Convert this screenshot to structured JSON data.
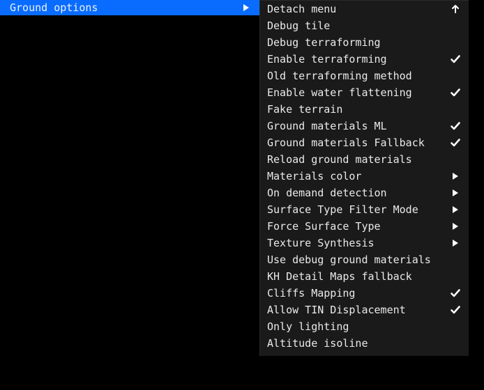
{
  "main": {
    "label": "Ground options",
    "selected": true,
    "icon": "submenu"
  },
  "submenu": {
    "items": [
      {
        "label": "Detach menu",
        "icon": "detach"
      },
      {
        "label": "Debug tile",
        "icon": "none"
      },
      {
        "label": "Debug terraforming",
        "icon": "none"
      },
      {
        "label": "Enable terraforming",
        "icon": "check"
      },
      {
        "label": "Old terraforming method",
        "icon": "none"
      },
      {
        "label": "Enable water flattening",
        "icon": "check"
      },
      {
        "label": "Fake terrain",
        "icon": "none"
      },
      {
        "label": "Ground materials ML",
        "icon": "check"
      },
      {
        "label": "Ground materials Fallback",
        "icon": "check"
      },
      {
        "label": "Reload ground materials",
        "icon": "none"
      },
      {
        "label": "Materials color",
        "icon": "submenu"
      },
      {
        "label": "On demand detection",
        "icon": "submenu"
      },
      {
        "label": "Surface Type Filter Mode",
        "icon": "submenu"
      },
      {
        "label": "Force Surface Type",
        "icon": "submenu"
      },
      {
        "label": "Texture Synthesis",
        "icon": "submenu"
      },
      {
        "label": "Use debug ground materials",
        "icon": "none"
      },
      {
        "label": "KH Detail Maps fallback",
        "icon": "none"
      },
      {
        "label": "Cliffs Mapping",
        "icon": "check"
      },
      {
        "label": "Allow TIN Displacement",
        "icon": "check"
      },
      {
        "label": "Only lighting",
        "icon": "none"
      },
      {
        "label": "Altitude isoline",
        "icon": "none"
      }
    ]
  }
}
